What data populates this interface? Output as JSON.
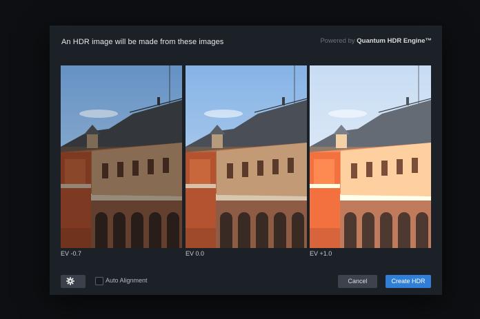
{
  "dialog": {
    "title": "An HDR image will be made from these images",
    "powered_prefix": "Powered by",
    "powered_brand": "Quantum HDR Engine™"
  },
  "images": [
    {
      "label": "EV -0.7",
      "exposure": -0.7
    },
    {
      "label": "EV 0.0",
      "exposure": 0.0
    },
    {
      "label": "EV +1.0",
      "exposure": 1.0
    }
  ],
  "footer": {
    "settings_icon": "gear-icon",
    "settings_dropdown_icon": "chevron-down-icon",
    "auto_alignment_label": "Auto Alignment",
    "auto_alignment_checked": false,
    "cancel_label": "Cancel",
    "create_label": "Create HDR"
  },
  "colors": {
    "dialog_bg": "#1c2128",
    "primary_button": "#2f7fd6",
    "secondary_button": "#3c434c"
  }
}
